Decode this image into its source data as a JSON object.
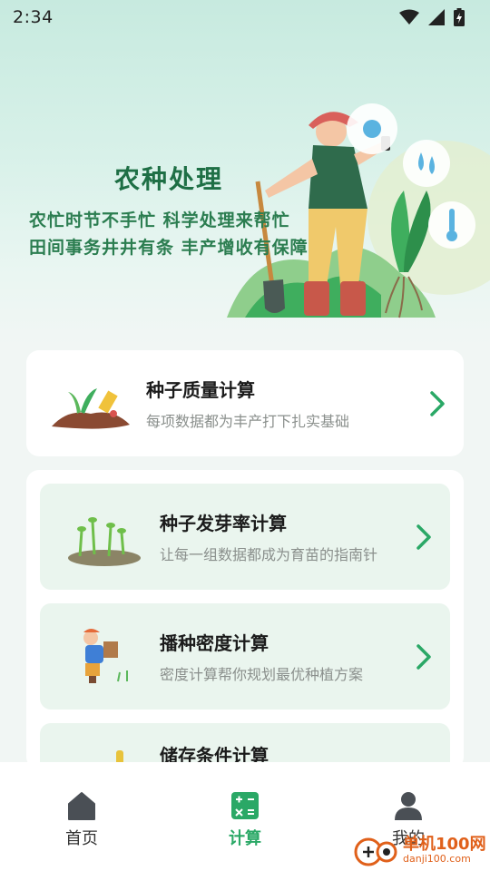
{
  "status_bar": {
    "time": "2:34"
  },
  "hero": {
    "title": "农种处理",
    "line1": "农忙时节不手忙  科学处理来帮忙",
    "line2": "田间事务井井有条  丰产增收有保障"
  },
  "cards": [
    {
      "title": "种子质量计算",
      "subtitle": "每项数据都为丰产打下扎实基础",
      "icon": "soil-seedling-icon"
    },
    {
      "title": "种子发芽率计算",
      "subtitle": "让每一组数据都成为育苗的指南针",
      "icon": "sprouts-icon"
    },
    {
      "title": "播种密度计算",
      "subtitle": "密度计算帮你规划最优种植方案",
      "icon": "farmer-sowing-icon"
    },
    {
      "title": "储存条件计算",
      "subtitle": "",
      "icon": "storage-icon"
    }
  ],
  "tabs": [
    {
      "label": "首页",
      "icon": "home-icon",
      "active": false
    },
    {
      "label": "计算",
      "icon": "calculator-icon",
      "active": true
    },
    {
      "label": "我的",
      "icon": "user-icon",
      "active": false
    }
  ],
  "watermark": {
    "main": "单机100网",
    "sub": "danji100.com"
  },
  "colors": {
    "accent": "#2aa866",
    "hero_text": "#1e6f45",
    "card_bg": "#eaf5ee",
    "watermark": "#e0601a"
  }
}
